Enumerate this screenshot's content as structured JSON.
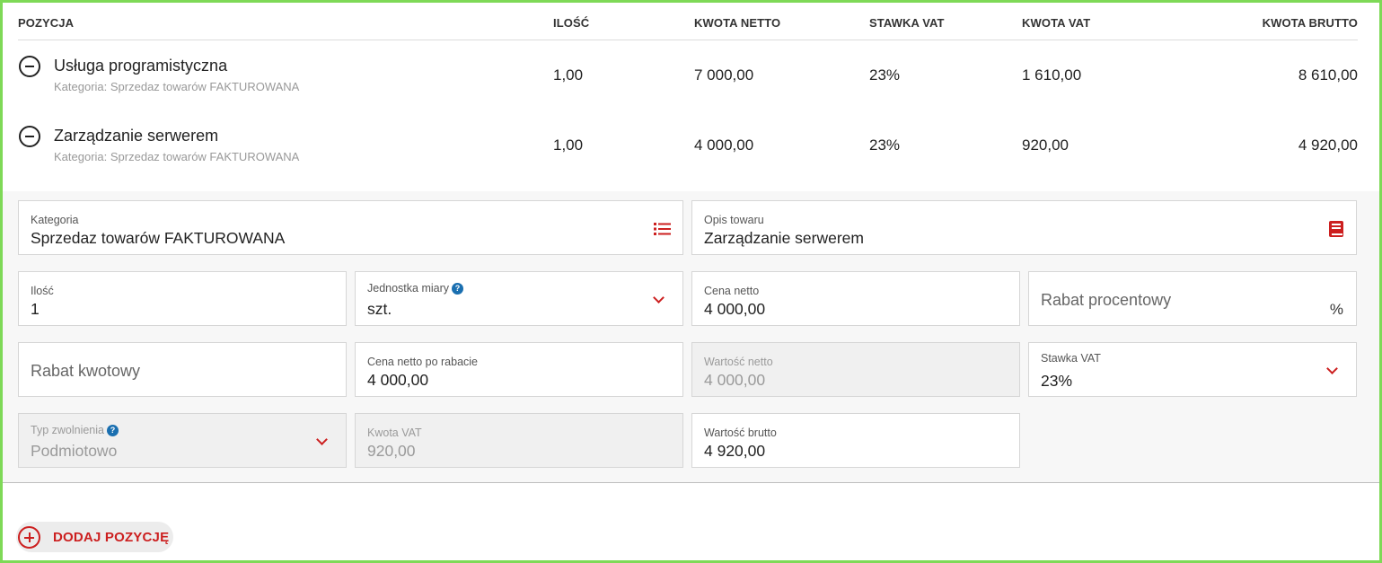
{
  "table": {
    "headers": {
      "position": "POZYCJA",
      "quantity": "ILOŚĆ",
      "net_amount": "KWOTA NETTO",
      "vat_rate": "STAWKA VAT",
      "vat_amount": "KWOTA VAT",
      "gross_amount": "KWOTA BRUTTO"
    },
    "rows": [
      {
        "name": "Usługa programistyczna",
        "category": "Kategoria: Sprzedaz towarów FAKTUROWANA",
        "quantity": "1,00",
        "net_amount": "7 000,00",
        "vat_rate": "23%",
        "vat_amount": "1 610,00",
        "gross_amount": "8 610,00"
      },
      {
        "name": "Zarządzanie serwerem",
        "category": "Kategoria: Sprzedaz towarów FAKTUROWANA",
        "quantity": "1,00",
        "net_amount": "4 000,00",
        "vat_rate": "23%",
        "vat_amount": "920,00",
        "gross_amount": "4 920,00"
      }
    ]
  },
  "form": {
    "category": {
      "label": "Kategoria",
      "value": "Sprzedaz towarów FAKTUROWANA",
      "icon": "list-icon"
    },
    "description": {
      "label": "Opis towaru",
      "value": "Zarządzanie serwerem",
      "icon": "book-icon"
    },
    "quantity": {
      "label": "Ilość",
      "value": "1"
    },
    "unit": {
      "label": "Jednostka miary",
      "help": "?",
      "value": "szt."
    },
    "net_price": {
      "label": "Cena netto",
      "value": "4 000,00"
    },
    "percent_discount": {
      "placeholder": "Rabat procentowy",
      "suffix": "%"
    },
    "amount_discount": {
      "placeholder": "Rabat kwotowy"
    },
    "net_price_after_discount": {
      "label": "Cena netto po rabacie",
      "value": "4 000,00"
    },
    "net_value": {
      "label": "Wartość netto",
      "value": "4 000,00"
    },
    "vat_rate": {
      "label": "Stawka VAT",
      "value": "23%"
    },
    "exemption_type": {
      "label": "Typ zwolnienia",
      "help": "?",
      "value": "Podmiotowo"
    },
    "vat_amount": {
      "label": "Kwota VAT",
      "value": "920,00"
    },
    "gross_value": {
      "label": "Wartość brutto",
      "value": "4 920,00"
    }
  },
  "actions": {
    "add_position": "DODAJ POZYCJĘ"
  },
  "colors": {
    "accent": "#cc1f1f",
    "frame": "#7ed957",
    "help": "#1a6fb0"
  }
}
